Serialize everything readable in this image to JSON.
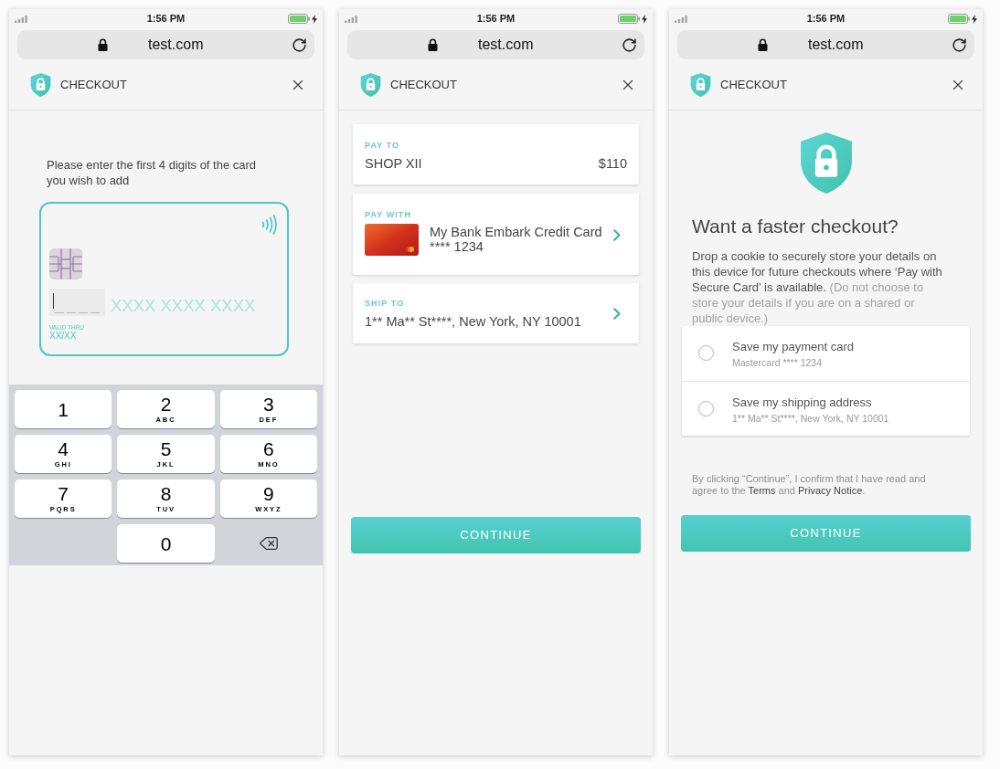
{
  "screens": [
    {
      "kind": "card_entry",
      "status_bar": {
        "time": "1:56 PM"
      },
      "address_bar": {
        "url": "test.com"
      },
      "header": {
        "title": "CHECKOUT"
      },
      "prompt": "Please enter the first 4 digits of the card you wish to add",
      "card": {
        "remaining_digits": "XXXX XXXX XXXX",
        "expiry_label": "VALID THRU",
        "expiry": "XX/XX"
      },
      "keypad": {
        "keys": [
          {
            "kind": "digit",
            "digit": "1"
          },
          {
            "kind": "digit",
            "digit": "2",
            "letters": "ABC"
          },
          {
            "kind": "digit",
            "digit": "3",
            "letters": "DEF"
          },
          {
            "kind": "digit",
            "digit": "4",
            "letters": "GHI"
          },
          {
            "kind": "digit",
            "digit": "5",
            "letters": "JKL"
          },
          {
            "kind": "digit",
            "digit": "6",
            "letters": "MNO"
          },
          {
            "kind": "digit",
            "digit": "7",
            "letters": "PQRS"
          },
          {
            "kind": "digit",
            "digit": "8",
            "letters": "TUV"
          },
          {
            "kind": "digit",
            "digit": "9",
            "letters": "WXYZ"
          },
          {
            "kind": "empty"
          },
          {
            "kind": "digit",
            "digit": "0"
          },
          {
            "kind": "delete"
          }
        ]
      }
    },
    {
      "kind": "review",
      "status_bar": {
        "time": "1:56 PM"
      },
      "address_bar": {
        "url": "test.com"
      },
      "header": {
        "title": "CHECKOUT"
      },
      "sections": [
        {
          "kind": "pay_to",
          "label": "PAY TO",
          "name": "SHOP XII",
          "amount": "$110"
        },
        {
          "kind": "pay_with",
          "label": "PAY WITH",
          "name": "My Bank Embark Credit Card",
          "number": "**** 1234"
        },
        {
          "kind": "ship_to",
          "label": "SHIP TO",
          "address": "1** Ma** St****, New York, NY 10001"
        }
      ],
      "button": "CONTINUE"
    },
    {
      "kind": "save_details",
      "status_bar": {
        "time": "1:56 PM"
      },
      "address_bar": {
        "url": "test.com"
      },
      "header": {
        "title": "CHECKOUT"
      },
      "title": "Want a faster checkout?",
      "description": {
        "text": "Drop a cookie to securely store your details on this device for future checkouts where ‘Pay with Secure Card’ is available.",
        "note": "(Do not choose to store your details if you are on a shared or public device.)"
      },
      "options": [
        {
          "title": "Save my payment card",
          "detail": "Mastercard **** 1234",
          "checked": false
        },
        {
          "title": "Save my shipping address",
          "detail": "1** Ma** St****, New York, NY 10001",
          "checked": false
        }
      ],
      "consent": [
        {
          "kind": "text",
          "text": "By clicking “Continue”, I confirm that I have read and agree to the "
        },
        {
          "kind": "link",
          "text": "Terms"
        },
        {
          "kind": "text",
          "text": " and "
        },
        {
          "kind": "link",
          "text": "Privacy Notice"
        },
        {
          "kind": "text",
          "text": "."
        }
      ],
      "button": "CONTINUE"
    }
  ]
}
